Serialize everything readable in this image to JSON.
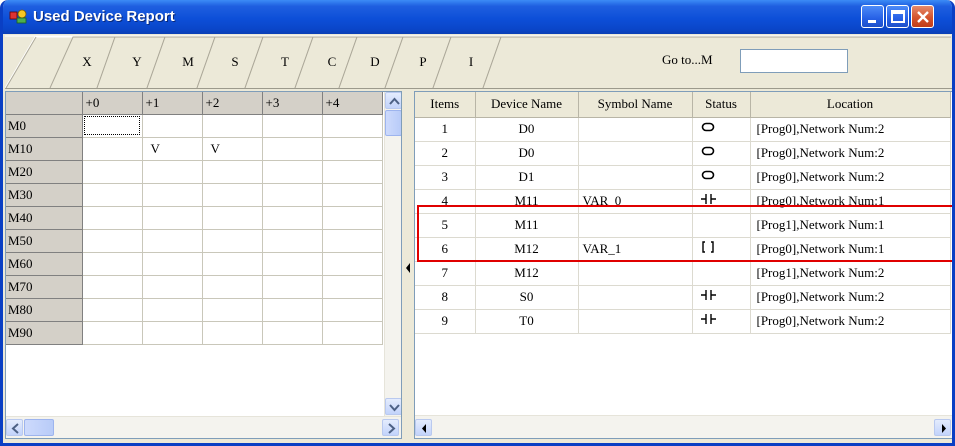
{
  "window": {
    "title": "Used Device Report",
    "buttons": {
      "minimize": "minimize",
      "maximize": "maximize",
      "close": "close"
    }
  },
  "tabs": [
    {
      "label": "X"
    },
    {
      "label": "Y"
    },
    {
      "label": "M"
    },
    {
      "label": "S"
    },
    {
      "label": "T"
    },
    {
      "label": "C"
    },
    {
      "label": "D"
    },
    {
      "label": "P"
    },
    {
      "label": "I"
    }
  ],
  "active_tab": "M",
  "goto": {
    "label": "Go to...M",
    "value": ""
  },
  "left_grid": {
    "columns": [
      "+0",
      "+1",
      "+2",
      "+3",
      "+4"
    ],
    "rows": [
      {
        "head": "M0",
        "cells": [
          "",
          "",
          "",
          "",
          ""
        ]
      },
      {
        "head": "M10",
        "cells": [
          "",
          "V",
          "V",
          "",
          ""
        ]
      },
      {
        "head": "M20",
        "cells": [
          "",
          "",
          "",
          "",
          ""
        ]
      },
      {
        "head": "M30",
        "cells": [
          "",
          "",
          "",
          "",
          ""
        ]
      },
      {
        "head": "M40",
        "cells": [
          "",
          "",
          "",
          "",
          ""
        ]
      },
      {
        "head": "M50",
        "cells": [
          "",
          "",
          "",
          "",
          ""
        ]
      },
      {
        "head": "M60",
        "cells": [
          "",
          "",
          "",
          "",
          ""
        ]
      },
      {
        "head": "M70",
        "cells": [
          "",
          "",
          "",
          "",
          ""
        ]
      },
      {
        "head": "M80",
        "cells": [
          "",
          "",
          "",
          "",
          ""
        ]
      },
      {
        "head": "M90",
        "cells": [
          "",
          "",
          "",
          "",
          ""
        ]
      }
    ]
  },
  "device_table": {
    "headers": [
      "Items",
      "Device Name",
      "Symbol Name",
      "Status",
      "Location"
    ],
    "rows": [
      {
        "item": "1",
        "device": "D0",
        "symbol": "",
        "status": "coil-icon",
        "location": "[Prog0],Network Num:2"
      },
      {
        "item": "2",
        "device": "D0",
        "symbol": "",
        "status": "coil-icon",
        "location": "[Prog0],Network Num:2"
      },
      {
        "item": "3",
        "device": "D1",
        "symbol": "",
        "status": "coil-icon",
        "location": "[Prog0],Network Num:2"
      },
      {
        "item": "4",
        "device": "M11",
        "symbol": "VAR_0",
        "status": "contact-icon",
        "location": "[Prog0],Network Num:1"
      },
      {
        "item": "5",
        "device": "M11",
        "symbol": "",
        "status": "",
        "location": "[Prog1],Network Num:1"
      },
      {
        "item": "6",
        "device": "M12",
        "symbol": "VAR_1",
        "status": "output-coil-icon",
        "location": "[Prog0],Network Num:1"
      },
      {
        "item": "7",
        "device": "M12",
        "symbol": "",
        "status": "",
        "location": "[Prog1],Network Num:2"
      },
      {
        "item": "8",
        "device": "S0",
        "symbol": "",
        "status": "contact-icon",
        "location": "[Prog0],Network Num:2"
      },
      {
        "item": "9",
        "device": "T0",
        "symbol": "",
        "status": "contact-icon",
        "location": "[Prog0],Network Num:2"
      }
    ]
  },
  "highlight_color": "#e00000",
  "title_bar_color": "#0a46c9"
}
